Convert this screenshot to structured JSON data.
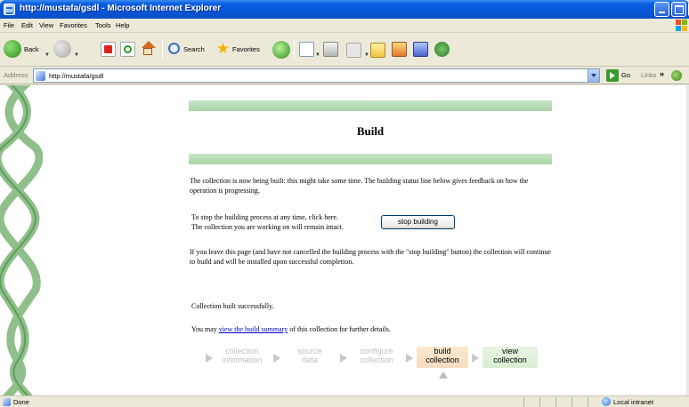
{
  "window": {
    "title": "http://mustafa/gsdl - Microsoft Internet Explorer"
  },
  "menu": {
    "items": [
      "File",
      "Edit",
      "View",
      "Favorites",
      "Tools",
      "Help"
    ]
  },
  "toolbar": {
    "back_label": "Back",
    "search_label": "Search",
    "favorites_label": "Favorites"
  },
  "address": {
    "label": "Address",
    "url": "http://mustafa/gsdl",
    "go_label": "Go",
    "links_label": "Links"
  },
  "page": {
    "title": "Build",
    "intro": "The collection is now being built: this might take some time. The building status line below gives feedback on how the operation is progressing.",
    "stop_line_1": "To stop the building process at any time, click here.",
    "stop_line_2": "The collection you are working on will remain intact.",
    "stop_button": "stop building",
    "leave_note": "If you leave this page (and have not cancelled the building process with the \"stop building\" button) the collection will continue to build and will be installed upon successful completion.",
    "built_status": "Collection built successfully.",
    "summary_prefix": "You may ",
    "summary_link": "view the build summary",
    "summary_suffix": " of this collection for further details.",
    "steps": [
      {
        "line1": "collection",
        "line2": "information",
        "state": "inactive"
      },
      {
        "line1": "source",
        "line2": "data",
        "state": "inactive"
      },
      {
        "line1": "configure",
        "line2": "collection",
        "state": "inactive"
      },
      {
        "line1": "build",
        "line2": "collection",
        "state": "current"
      },
      {
        "line1": "view",
        "line2": "collection",
        "state": "active"
      }
    ]
  },
  "status": {
    "text": "Done",
    "zone": "Local intranet"
  },
  "colors": {
    "titlebar": "#0a5fe0",
    "band": "#b4dab1",
    "link": "#0000cc",
    "current_step": "#fbe3c8"
  }
}
